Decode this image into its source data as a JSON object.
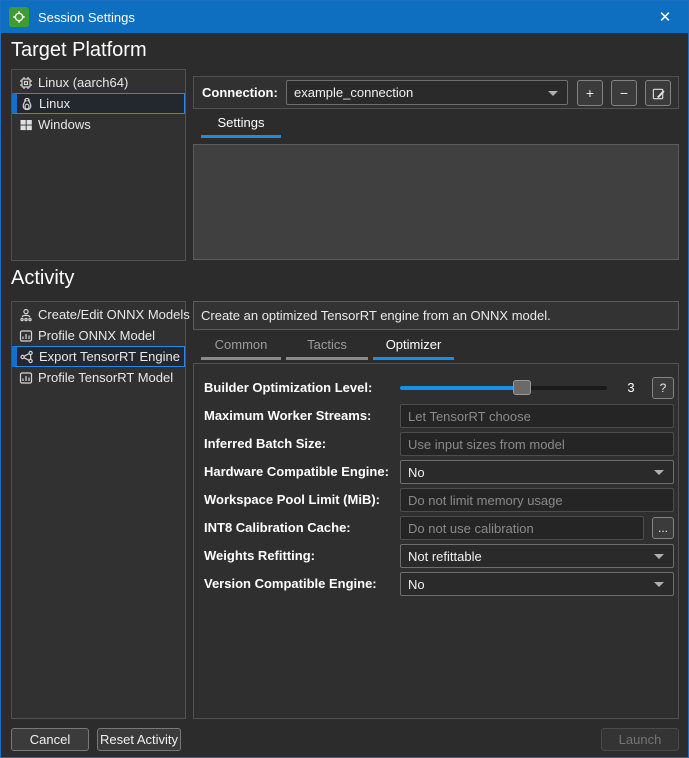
{
  "window": {
    "title": "Session Settings",
    "close_glyph": "✕"
  },
  "colors": {
    "titlebar": "#0e6fc0",
    "accent": "#1b8de4",
    "selection_border": "#2e86e0",
    "app_icon_green": "#3f9c30"
  },
  "target_platform": {
    "heading": "Target Platform",
    "items": [
      {
        "label": "Linux (aarch64)",
        "icon": "chip-icon",
        "selected": false
      },
      {
        "label": "Linux",
        "icon": "penguin-icon",
        "selected": true
      },
      {
        "label": "Windows",
        "icon": "windows-icon",
        "selected": false
      }
    ]
  },
  "connection": {
    "label": "Connection:",
    "selected_value": "example_connection",
    "add_glyph": "+",
    "remove_glyph": "−"
  },
  "settings_tab": {
    "label": "Settings"
  },
  "activity": {
    "heading": "Activity",
    "items": [
      {
        "label": "Create/Edit ONNX Models",
        "icon": "person-network-icon",
        "selected": false
      },
      {
        "label": "Profile ONNX Model",
        "icon": "chart-icon",
        "selected": false
      },
      {
        "label": "Export TensorRT Engine",
        "icon": "graph-icon",
        "selected": true
      },
      {
        "label": "Profile TensorRT Model",
        "icon": "chart-icon",
        "selected": false
      }
    ],
    "description": "Create an optimized TensorRT engine from an ONNX model.",
    "tabs": [
      {
        "label": "Common",
        "active": false
      },
      {
        "label": "Tactics",
        "active": false
      },
      {
        "label": "Optimizer",
        "active": true
      }
    ]
  },
  "form": {
    "rows": [
      {
        "label": "Builder Optimization Level:",
        "type": "slider",
        "value": "3",
        "help_glyph": "?",
        "range_hint": "0-5"
      },
      {
        "label": "Maximum Worker Streams:",
        "type": "input",
        "placeholder": "Let TensorRT choose"
      },
      {
        "label": "Inferred Batch Size:",
        "type": "input",
        "placeholder": "Use input sizes from model"
      },
      {
        "label": "Hardware Compatible Engine:",
        "type": "select",
        "value": "No"
      },
      {
        "label": "Workspace Pool Limit (MiB):",
        "type": "input",
        "placeholder": "Do not limit memory usage"
      },
      {
        "label": "INT8 Calibration Cache:",
        "type": "input",
        "placeholder": "Do not use calibration",
        "browse_glyph": "..."
      },
      {
        "label": "Weights Refitting:",
        "type": "select",
        "value": "Not refittable"
      },
      {
        "label": "Version Compatible Engine:",
        "type": "select",
        "value": "No"
      }
    ]
  },
  "footer": {
    "cancel": "Cancel",
    "reset": "Reset Activity",
    "launch": "Launch"
  }
}
